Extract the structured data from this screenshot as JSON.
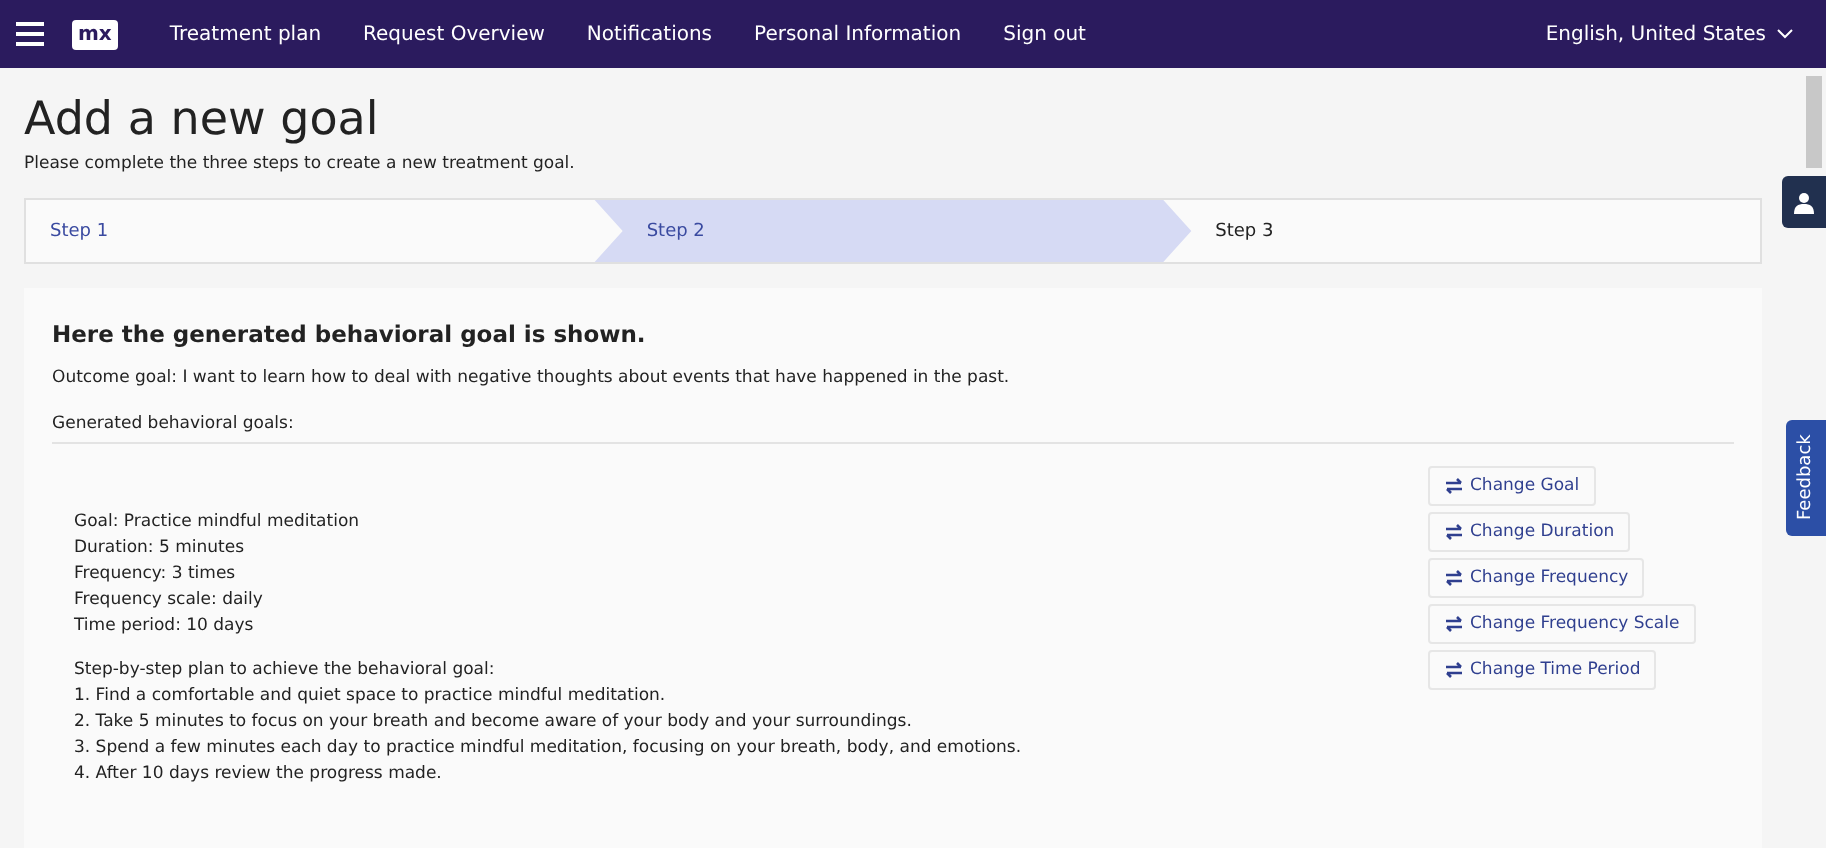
{
  "navbar": {
    "menu": [
      "Treatment plan",
      "Request Overview",
      "Notifications",
      "Personal Information",
      "Sign out"
    ],
    "language": "English, United States",
    "logo": "mx"
  },
  "title": "Add a new goal",
  "subtitle": "Please complete the three steps to create a new treatment goal.",
  "steps": [
    {
      "label": "Step 1",
      "selected": false
    },
    {
      "label": "Step 2",
      "selected": true
    },
    {
      "label": "Step 3",
      "selected": false
    }
  ],
  "card": {
    "heading": "Here the generated behavioral goal is shown.",
    "outcome": "Outcome goal: I want to learn how to deal with negative thoughts about events that have happened in the past.",
    "generated_label": "Generated behavioral goals:",
    "details": [
      "Goal: Practice mindful meditation",
      "Duration: 5 minutes",
      "Frequency: 3 times",
      "Frequency scale: daily",
      "Time period: 10 days"
    ],
    "plan": [
      "Step-by-step plan to achieve the behavioral goal:",
      "1. Find a comfortable and quiet space to practice mindful meditation.",
      "2. Take 5 minutes to focus on your breath and become aware of your body and your surroundings.",
      "3. Spend a few minutes each day to practice mindful meditation, focusing on your breath, body, and emotions.",
      "4. After 10 days review the progress made."
    ],
    "buttons": [
      "Change Goal",
      "Change Duration",
      "Change Frequency",
      "Change Frequency Scale",
      "Change Time Period"
    ]
  },
  "feedback": "Feedback"
}
